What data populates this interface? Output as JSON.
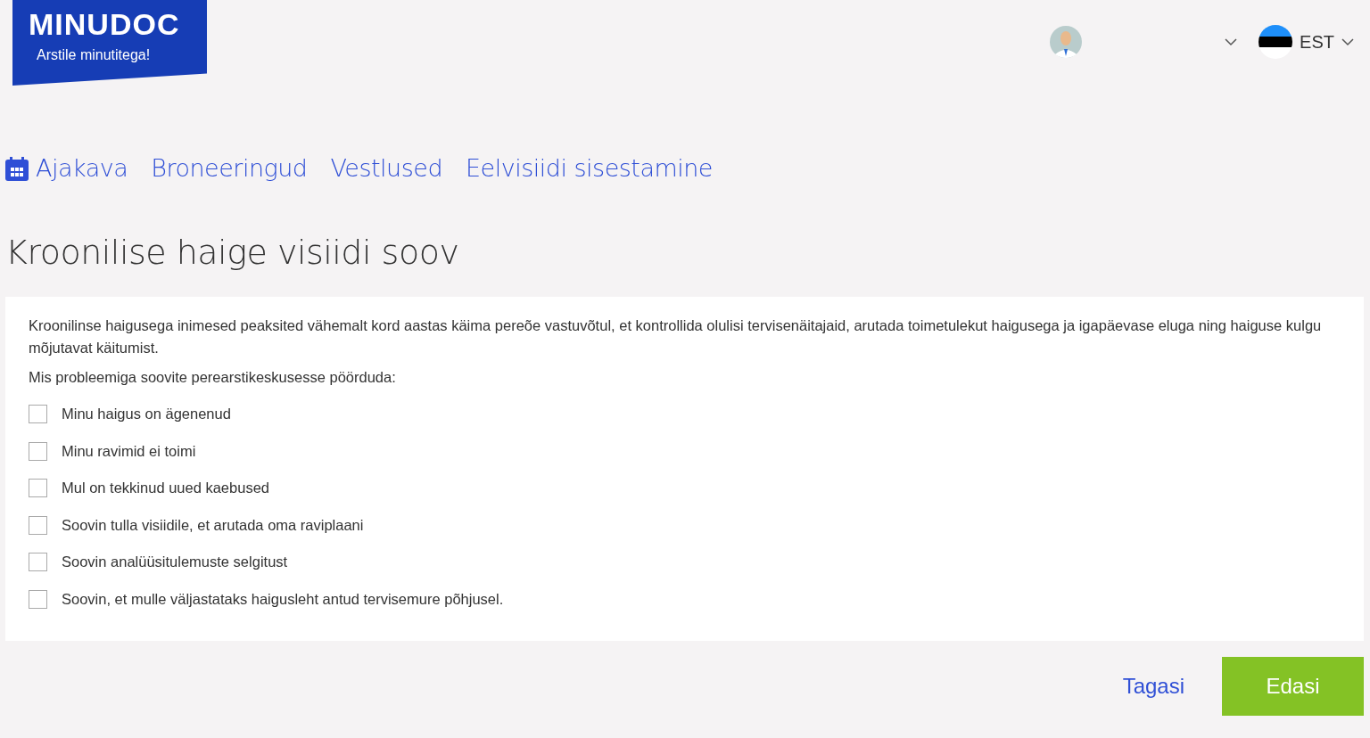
{
  "logo": {
    "name": "MINUDOC",
    "tagline": "Arstile minutitega!"
  },
  "header": {
    "language": "EST"
  },
  "nav": [
    {
      "label": "Ajakava",
      "kind": "iconlink"
    },
    {
      "label": "Broneeringud",
      "kind": "link"
    },
    {
      "label": "Vestlused",
      "kind": "link"
    },
    {
      "label": "Eelvisiidi sisestamine",
      "kind": "link"
    }
  ],
  "page_title": "Kroonilise haige visiidi soov",
  "form": {
    "intro": "Kroonilinse haigusega inimesed peaksited vähemalt kord aastas käima pereõe vastuvõtul, et kontrollida olulisi tervisenäitajaid, arutada toimetulekut haigusega ja igapäevase eluga ning haiguse kulgu mõjutavat käitumist.",
    "question": "Mis probleemiga soovite perearstikeskusesse pöörduda:",
    "options": [
      {
        "label": "Minu haigus on ägenenud",
        "checked": false
      },
      {
        "label": "Minu ravimid ei toimi",
        "checked": false
      },
      {
        "label": "Mul on tekkinud uued kaebused",
        "checked": false
      },
      {
        "label": "Soovin tulla visiidile, et arutada oma raviplaani",
        "checked": false
      },
      {
        "label": "Soovin analüüsitulemuste selgitust",
        "checked": false
      },
      {
        "label": "Soovin, et mulle väljastataks haigusleht antud tervisemure põhjusel.",
        "checked": false
      }
    ]
  },
  "buttons": {
    "back": "Tagasi",
    "next": "Edasi"
  }
}
